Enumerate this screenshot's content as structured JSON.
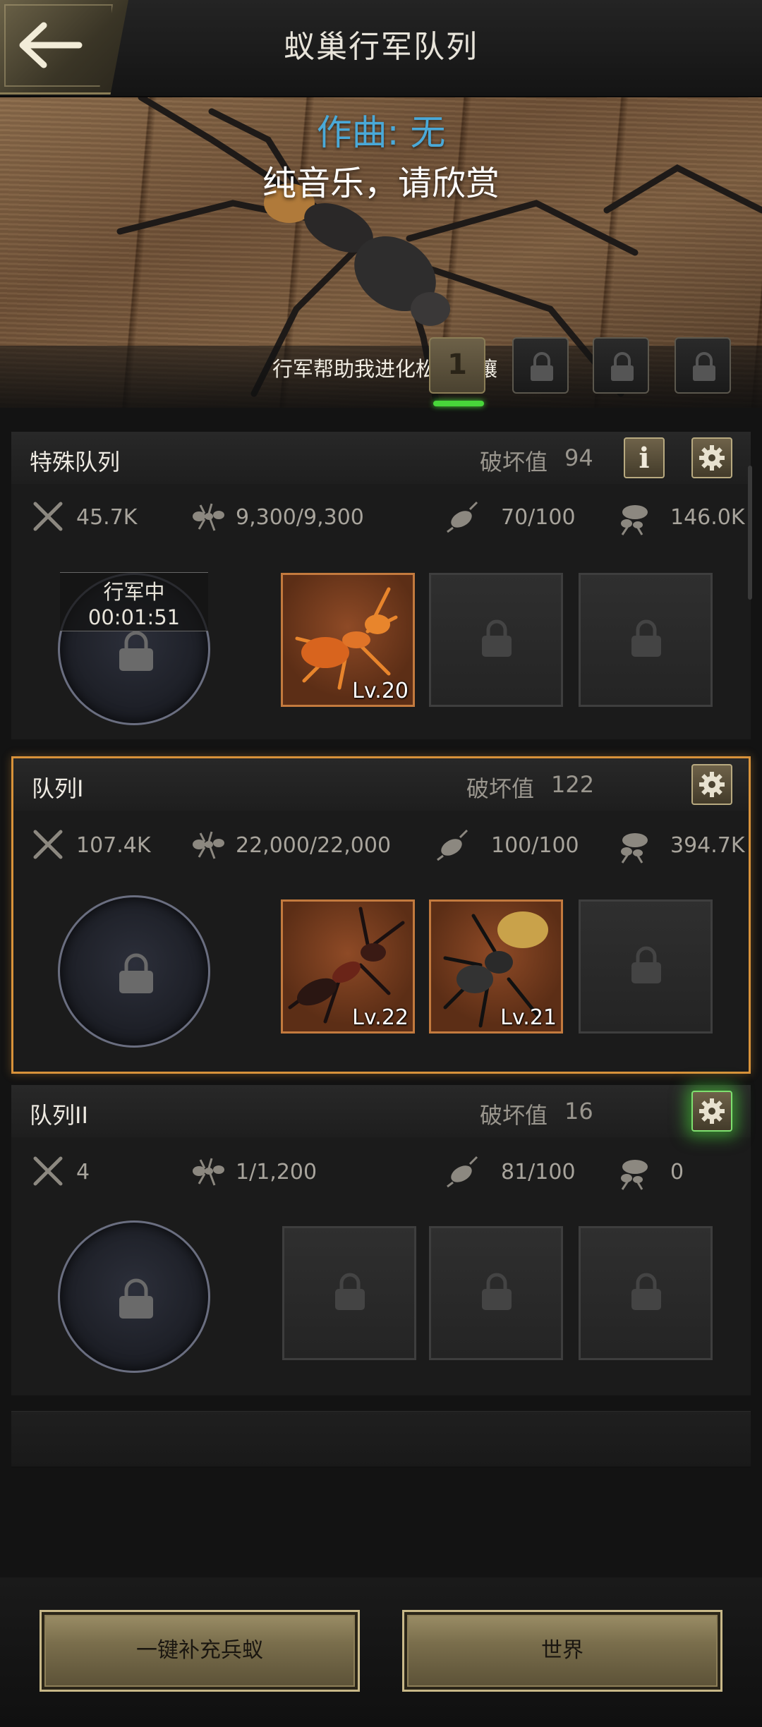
{
  "header": {
    "title": "蚁巢行军队列",
    "back_icon": "arrow-left-icon"
  },
  "banner": {
    "composer": "作曲: 无",
    "lyric": "纯音乐，请欣赏",
    "caption": "行军帮助我进化松软土壤",
    "tabs": [
      {
        "label": "1",
        "state": "active"
      },
      {
        "label": "",
        "state": "locked"
      },
      {
        "label": "",
        "state": "locked"
      },
      {
        "label": "",
        "state": "locked"
      }
    ]
  },
  "queues": [
    {
      "name": "特殊队列",
      "power_label": "破坏值",
      "power": "94",
      "stats": {
        "attack": "45.7K",
        "troops": "9,300/9,300",
        "load": "70/100",
        "capacity": "146.0K"
      },
      "status": "行军中",
      "timer": "00:01:51",
      "slots": [
        {
          "level": "Lv.20"
        },
        {
          "level": ""
        },
        {
          "level": ""
        }
      ]
    },
    {
      "name": "队列I",
      "power_label": "破坏值",
      "power": "122",
      "stats": {
        "attack": "107.4K",
        "troops": "22,000/22,000",
        "load": "100/100",
        "capacity": "394.7K"
      },
      "slots": [
        {
          "level": "Lv.22"
        },
        {
          "level": "Lv.21"
        },
        {
          "level": ""
        }
      ]
    },
    {
      "name": "队列II",
      "power_label": "破坏值",
      "power": "16",
      "stats": {
        "attack": "4",
        "troops": "1/1,200",
        "load": "81/100",
        "capacity": "0"
      },
      "slots": [
        {
          "level": ""
        },
        {
          "level": ""
        },
        {
          "level": ""
        }
      ]
    }
  ],
  "buttons": {
    "replenish": "一键补充兵蚁",
    "world": "世界"
  },
  "colors": {
    "accent_gold": "#c8b888",
    "highlight_orange": "#d8923a",
    "composer_blue": "#4aa9d8",
    "active_green": "#48d63a"
  }
}
